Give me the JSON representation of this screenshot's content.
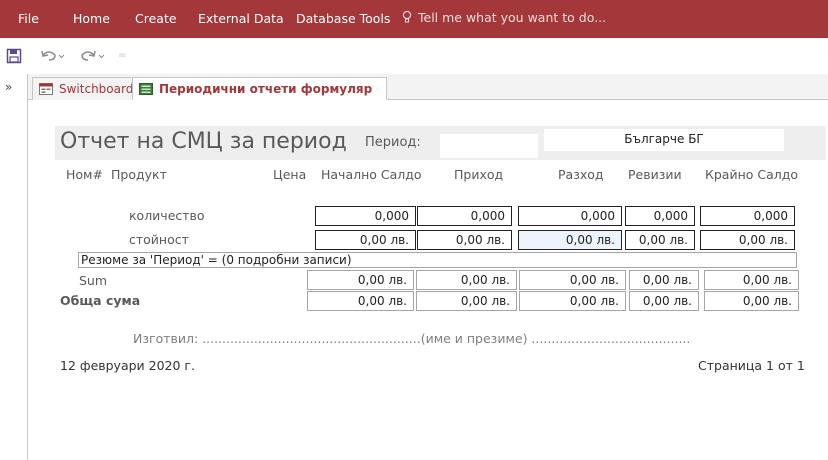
{
  "ribbon": {
    "tabs": [
      "File",
      "Home",
      "Create",
      "External Data",
      "Database Tools"
    ],
    "tell_me": "Tell me what you want to do...",
    "accent_color": "#a4373a"
  },
  "qat": {
    "icons": [
      "save-icon",
      "undo-icon",
      "redo-icon"
    ]
  },
  "nav": {
    "toggle": "»"
  },
  "doc_tabs": [
    {
      "label": "Switchboard"
    },
    {
      "label": "Периодични отчети формуляр"
    }
  ],
  "report": {
    "title": "Отчет на СМЦ за период",
    "period_label": "Период:",
    "period_value": "",
    "company": "Българче БГ",
    "columns": {
      "nom": "Ном#",
      "product": "Продукт",
      "price": "Цена",
      "opening": "Начално Салдо",
      "income": "Приход",
      "expense": "Разход",
      "revisions": "Ревизии",
      "closing": "Крайно Салдо"
    },
    "rows": {
      "quantity": {
        "label": "количество",
        "values": [
          "0,000",
          "0,000",
          "0,000",
          "0,000",
          "0,000"
        ]
      },
      "value": {
        "label": "стойност",
        "values": [
          "0,00 лв.",
          "0,00 лв.",
          "0,00 лв.",
          "0,00 лв.",
          "0,00 лв."
        ]
      }
    },
    "summary": "Резюме за 'Период' =   (0 подробни записи)",
    "sum": {
      "label": "Sum",
      "values": [
        "0,00 лв.",
        "0,00 лв.",
        "0,00 лв.",
        "0,00 лв.",
        "0,00 лв."
      ]
    },
    "total": {
      "label": "Обща сума",
      "values": [
        "0,00 лв.",
        "0,00 лв.",
        "0,00 лв.",
        "0,00 лв.",
        "0,00 лв."
      ]
    },
    "signature": "Изготвил: .......................................................(име и презиме)  ........................................(подпис)",
    "date": "12 февруари 2020 г.",
    "page": "Страница 1 от 1"
  }
}
